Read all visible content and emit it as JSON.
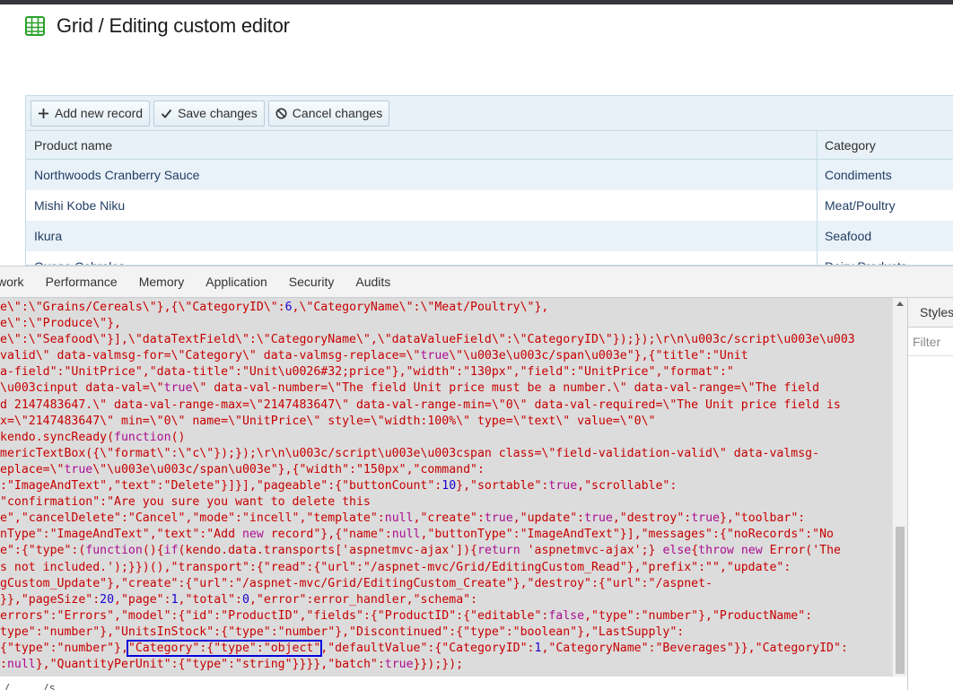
{
  "header": {
    "icon": "grid-icon",
    "title": "Grid / Editing custom editor"
  },
  "toolbar": {
    "add_label": "Add new record",
    "save_label": "Save changes",
    "cancel_label": "Cancel changes"
  },
  "grid": {
    "columns": [
      "Product name",
      "Category"
    ],
    "rows": [
      [
        "Northwoods Cranberry Sauce",
        "Condiments"
      ],
      [
        "Mishi Kobe Niku",
        "Meat/Poultry"
      ],
      [
        "Ikura",
        "Seafood"
      ],
      [
        "Queso Cabrales",
        "Dairy Products"
      ]
    ]
  },
  "devtools": {
    "tabs": [
      "work",
      "Performance",
      "Memory",
      "Application",
      "Security",
      "Audits"
    ],
    "styles_tab": "Styles",
    "filter_placeholder": "Filter",
    "code_lines": [
      "e\\\":\\\"Grains/Cereals\\\"},{\\\"CategoryID\\\":6,\\\"CategoryName\\\":\\\"Meat/Poultry\\\"},",
      "e\\\":\\\"Produce\\\"},",
      "e\\\":\\\"Seafood\\\"}],\\\"dataTextField\\\":\\\"CategoryName\\\",\\\"dataValueField\\\":\\\"CategoryID\\\"});});\\r\\n\\u003c/script\\u003e\\u003",
      "valid\\\" data-valmsg-for=\\\"Category\\\" data-valmsg-replace=\\\"true\\\"\\u003e\\u003c/span\\u003e\"},{\"title\":\"Unit",
      "a-field\":\"UnitPrice\",\"data-title\":\"Unit\\u0026#32;price\"},\"width\":\"130px\",\"field\":\"UnitPrice\",\"format\":\"",
      "\\u003cinput data-val=\\\"true\\\" data-val-number=\\\"The field Unit price must be a number.\\\" data-val-range=\\\"The field",
      "d 2147483647.\\\" data-val-range-max=\\\"2147483647\\\" data-val-range-min=\\\"0\\\" data-val-required=\\\"The Unit price field is",
      "x=\\\"2147483647\\\" min=\\\"0\\\" name=\\\"UnitPrice\\\" style=\\\"width:100%\\\" type=\\\"text\\\" value=\\\"0\\\"",
      "kendo.syncReady(function()",
      "mericTextBox({\\\"format\\\":\\\"c\\\"});});\\r\\n\\u003c/script\\u003e\\u003cspan class=\\\"field-validation-valid\\\" data-valmsg-",
      "eplace=\\\"true\\\"\\u003e\\u003c/span\\u003e\"},{\"width\":\"150px\",\"command\":",
      ":\"ImageAndText\",\"text\":\"Delete\"}]}],\"pageable\":{\"buttonCount\":10},\"sortable\":true,\"scrollable\":",
      "\"confirmation\":\"Are you sure you want to delete this",
      "e\",\"cancelDelete\":\"Cancel\",\"mode\":\"incell\",\"template\":null,\"create\":true,\"update\":true,\"destroy\":true},\"toolbar\":",
      "nType\":\"ImageAndText\",\"text\":\"Add new record\"},{\"name\":null,\"buttonType\":\"ImageAndText\"}],\"messages\":{\"noRecords\":\"No",
      "e\":{\"type\":(function(){if(kendo.data.transports['aspnetmvc-ajax']){return 'aspnetmvc-ajax';} else{throw new Error('The",
      "s not included.');}})(),\"transport\":{\"read\":{\"url\":\"/aspnet-mvc/Grid/EditingCustom_Read\"},\"prefix\":\"\",\"update\":",
      "gCustom_Update\"},\"create\":{\"url\":\"/aspnet-mvc/Grid/EditingCustom_Create\"},\"destroy\":{\"url\":\"/aspnet-",
      "}},\"pageSize\":20,\"page\":1,\"total\":0,\"error\":error_handler,\"schema\":",
      "errors\":\"Errors\",\"model\":{\"id\":\"ProductID\",\"fields\":{\"ProductID\":{\"editable\":false,\"type\":\"number\"},\"ProductName\":",
      "type\":\"number\"},\"UnitsInStock\":{\"type\":\"number\"},\"Discontinued\":{\"type\":\"boolean\"},\"LastSupply\":",
      "{\"type\":\"number\"},",
      ":null},\"QuantityPerUnit\":{\"type\":\"string\"}}}},\"batch\":true}});});"
    ],
    "highlight_line": {
      "prefix": "{\"type\":\"number\"},",
      "highlight": "\"Category\":{\"type\":\"object\"",
      "suffix": ",\"defaultValue\":{\"CategoryID\":1,\"CategoryName\":\"Beverages\"}},\"CategoryID\":"
    },
    "bottom_text": "/ ... /s",
    "colors": {
      "string": "#c80000",
      "number": "#1c00cf",
      "keyword": "#aa0d91",
      "highlight_box": "#0000dd"
    }
  }
}
